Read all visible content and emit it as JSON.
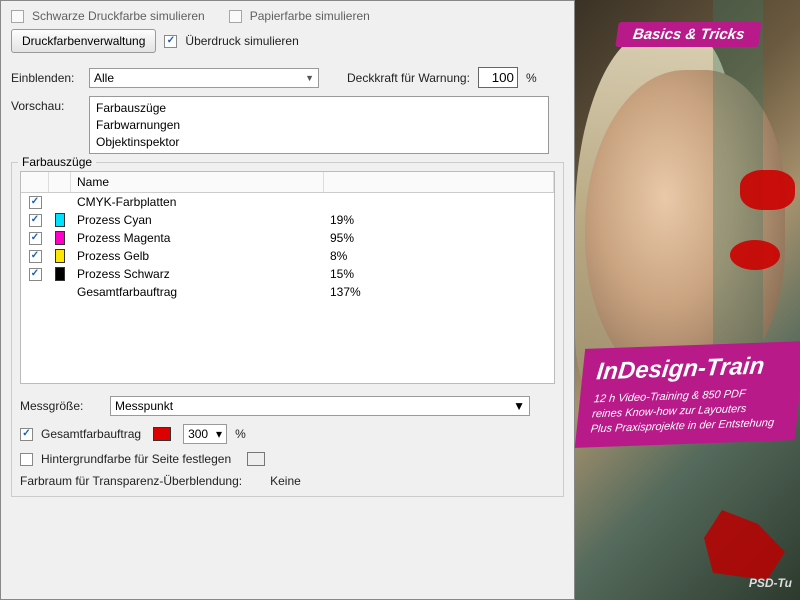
{
  "top": {
    "sim_black": "Schwarze Druckfarbe simulieren",
    "sim_paper": "Papierfarbe simulieren",
    "btn_ink": "Druckfarbenverwaltung",
    "overprint": "Überdruck simulieren"
  },
  "blend": {
    "label": "Einblenden:",
    "value": "Alle",
    "opacity_label": "Deckkraft für Warnung:",
    "opacity_value": "100",
    "unit": "%"
  },
  "preview": {
    "label": "Vorschau:",
    "items": [
      "Farbauszüge",
      "Farbwarnungen",
      "Objektinspektor"
    ]
  },
  "group": {
    "title": "Farbauszüge",
    "header": "Name",
    "rows": [
      {
        "chk": true,
        "swatch": "",
        "name": "CMYK-Farbplatten",
        "val": ""
      },
      {
        "chk": true,
        "swatch": "cyan",
        "name": "Prozess Cyan",
        "val": "19%"
      },
      {
        "chk": true,
        "swatch": "magenta",
        "name": "Prozess Magenta",
        "val": "95%"
      },
      {
        "chk": true,
        "swatch": "yellow",
        "name": "Prozess Gelb",
        "val": "8%"
      },
      {
        "chk": true,
        "swatch": "black",
        "name": "Prozess Schwarz",
        "val": "15%"
      },
      {
        "chk": false,
        "swatch": "",
        "name": "Gesamtfarbauftrag",
        "val": "137%"
      }
    ],
    "measure_label": "Messgröße:",
    "measure_value": "Messpunkt",
    "total_ink": "Gesamtfarbauftrag",
    "total_ink_val": "300",
    "total_ink_unit": "%",
    "bg_color": "Hintergrundfarbe für Seite festlegen",
    "trans_label": "Farbraum für Transparenz-Überblendung:",
    "trans_value": "Keine"
  },
  "promo": {
    "badge": "Basics & Tricks",
    "title": "InDesign-Train",
    "line1": "12 h Video-Training & 850 PDF",
    "line2": "reines Know-how zur Layouters",
    "line3": "Plus Praxisprojekte in der Entstehung",
    "footer": "PSD-Tu"
  }
}
